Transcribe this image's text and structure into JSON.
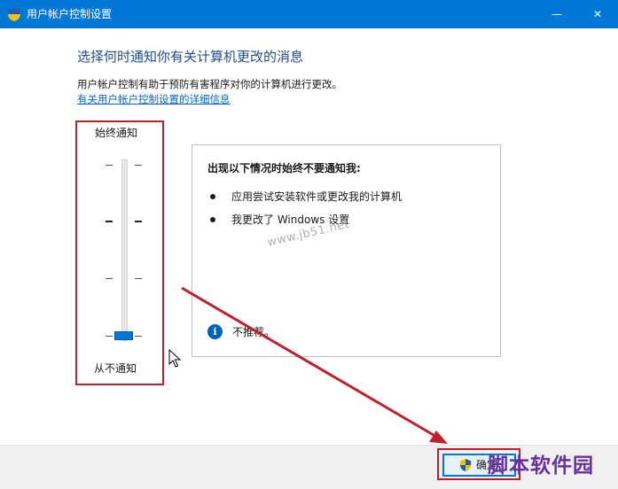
{
  "window": {
    "title": "用户帐户控制设置",
    "minimize_glyph": "—",
    "close_glyph": "✕"
  },
  "content": {
    "heading": "选择何时通知你有关计算机更改的消息",
    "description": "用户帐户控制有助于预防有害程序对你的计算机进行更改。",
    "link": "有关用户帐户控制设置的详细信息"
  },
  "slider": {
    "top_label": "始终通知",
    "bottom_label": "从不通知",
    "levels": 4,
    "selected_level": 1,
    "selected_label": "从不通知"
  },
  "panel": {
    "title": "出现以下情况时始终不要通知我:",
    "bullets": [
      "应用尝试安装软件或更改我的计算机",
      "我更改了 Windows 设置"
    ],
    "info_icon": "info-icon",
    "info_text": "不推荐。"
  },
  "watermark": "www.jb51.net",
  "footer": {
    "ok_label": "确定",
    "brand": "脚本软件园"
  },
  "colors": {
    "titlebar": "#0078d7",
    "heading": "#1f4e8c",
    "link": "#0066cc",
    "annotation_red": "#c0202a",
    "slider_thumb": "#0078d7"
  },
  "icons": [
    "uac-shield-icon",
    "info-icon",
    "mouse-cursor-icon",
    "annotation-arrow"
  ]
}
